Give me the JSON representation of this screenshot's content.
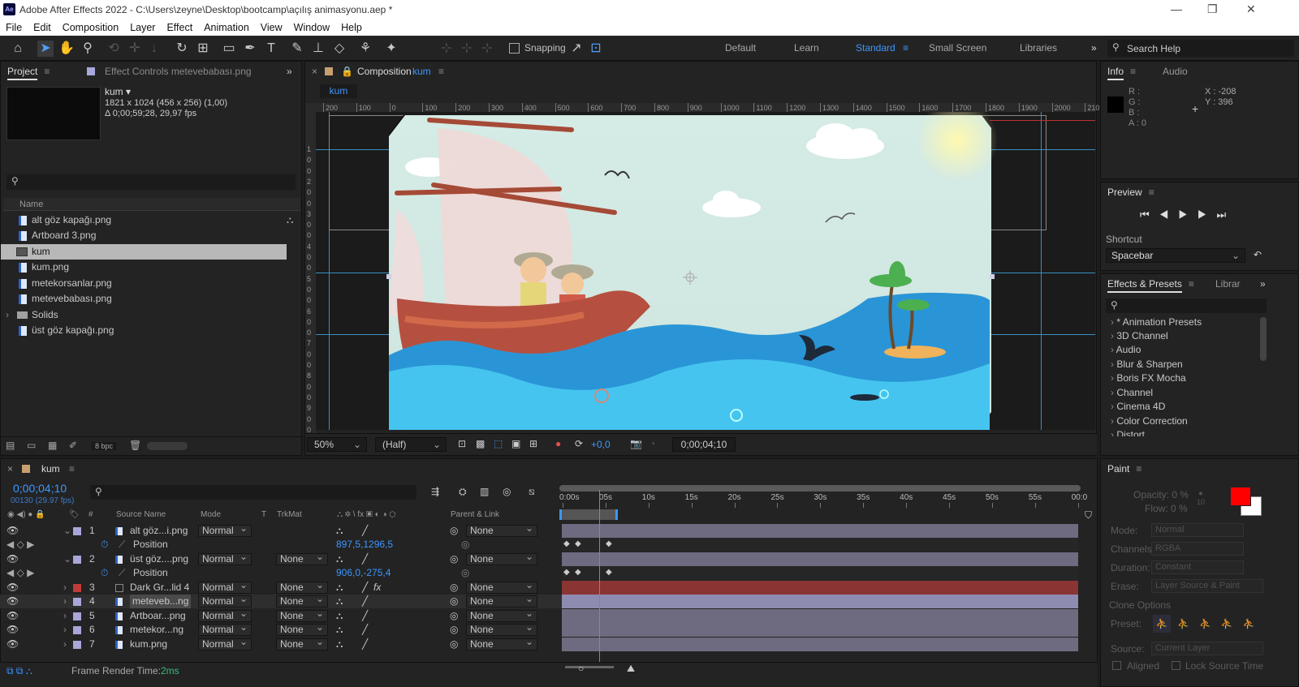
{
  "window": {
    "title": "Adobe After Effects 2022 - C:\\Users\\zeyne\\Desktop\\bootcamp\\açılış animasyonu.aep *",
    "icon": "Ae",
    "min": "—",
    "max": "❐",
    "close": "✕"
  },
  "menu": [
    "File",
    "Edit",
    "Composition",
    "Layer",
    "Effect",
    "Animation",
    "View",
    "Window",
    "Help"
  ],
  "toolbar": {
    "snapping": "Snapping",
    "workspaces": [
      "Default",
      "Learn",
      "Standard",
      "Small Screen",
      "Libraries"
    ],
    "search": "Search Help"
  },
  "project": {
    "tab": "Project",
    "effect_tab": "Effect Controls metevebabası.png",
    "comp_name": "kum ▾",
    "dims": "1821 x 1024  (456 x 256) (1,00)",
    "duration": "Δ 0;00;59;28, 29,97 fps",
    "name_col": "Name",
    "bpc": "8 bpc",
    "items": [
      {
        "name": "alt göz kapağı.png",
        "type": "file"
      },
      {
        "name": "Artboard 3.png",
        "type": "file"
      },
      {
        "name": "kum",
        "type": "comp"
      },
      {
        "name": "kum.png",
        "type": "file"
      },
      {
        "name": "metekorsanlar.png",
        "type": "file"
      },
      {
        "name": "metevebabası.png",
        "type": "file"
      },
      {
        "name": "Solids",
        "type": "folder"
      },
      {
        "name": "üst göz kapağı.png",
        "type": "file"
      }
    ]
  },
  "composition": {
    "tab_prefix": "Composition",
    "tab_name": "kum",
    "sub_tab": "kum",
    "zoom": "50%",
    "resolution": "(Half)",
    "exposure": "+0,0",
    "timecode": "0;00;04;10",
    "ruler": [
      "200",
      "100",
      "0",
      "100",
      "200",
      "300",
      "400",
      "500",
      "600",
      "700",
      "800",
      "900",
      "1000",
      "1100",
      "1200",
      "1300",
      "1400",
      "1500",
      "1600",
      "1700",
      "1800",
      "1900",
      "2000",
      "210"
    ],
    "vruler": [
      "1",
      "0",
      "0",
      "2",
      "0",
      "0",
      "3",
      "0",
      "0",
      "4",
      "0",
      "0",
      "5",
      "0",
      "0",
      "6",
      "0",
      "0",
      "7",
      "0",
      "0",
      "8",
      "0",
      "0",
      "9",
      "0",
      "0"
    ]
  },
  "info": {
    "tab": "Info",
    "audio_tab": "Audio",
    "r": "R :",
    "g": "G :",
    "b": "B :",
    "a": "A :  0",
    "x": "X : -208",
    "y": "Y :  396"
  },
  "preview": {
    "title": "Preview",
    "shortcut_label": "Shortcut",
    "shortcut": "Spacebar"
  },
  "effects": {
    "title": "Effects & Presets",
    "libs": "Librar",
    "items": [
      "* Animation Presets",
      "3D Channel",
      "Audio",
      "Blur & Sharpen",
      "Boris FX Mocha",
      "Channel",
      "Cinema 4D",
      "Color Correction",
      "Distort"
    ]
  },
  "timeline": {
    "tab": "kum",
    "timecode": "0;00;04;10",
    "fps": "00130 (29.97 fps)",
    "headers": {
      "num": "#",
      "source": "Source Name",
      "mode": "Mode",
      "t": "T",
      "trkmat": "TrkMat",
      "parent": "Parent & Link"
    },
    "ticks": [
      "0:00s",
      "05s",
      "10s",
      "15s",
      "20s",
      "25s",
      "30s",
      "35s",
      "40s",
      "45s",
      "50s",
      "55s",
      "00:0"
    ],
    "playhead_seconds": 4.34,
    "duration_seconds": 60,
    "layers": [
      {
        "num": "1",
        "name": "alt göz...i.png",
        "mode": "Normal",
        "trkmat": "",
        "parent": "None",
        "color": "#a9a6d9",
        "expanded": true,
        "prop": "Position",
        "value": "897,5,1296,5"
      },
      {
        "num": "2",
        "name": "üst göz....png",
        "mode": "Normal",
        "trkmat": "None",
        "parent": "None",
        "color": "#a9a6d9",
        "expanded": true,
        "prop": "Position",
        "value": "906,0,-275,4"
      },
      {
        "num": "3",
        "name": "Dark Gr...lid 4",
        "mode": "Normal",
        "trkmat": "None",
        "parent": "None",
        "color": "#c23a3a",
        "bar": "#8a3434",
        "fx": "fx"
      },
      {
        "num": "4",
        "name": "meteveb...ng",
        "mode": "Normal",
        "trkmat": "None",
        "parent": "None",
        "color": "#a9a6d9",
        "bar": "#8e8bb0"
      },
      {
        "num": "5",
        "name": "Artboar...png",
        "mode": "Normal",
        "trkmat": "None",
        "parent": "None",
        "color": "#a9a6d9"
      },
      {
        "num": "6",
        "name": "metekor...ng",
        "mode": "Normal",
        "trkmat": "None",
        "parent": "None",
        "color": "#a9a6d9"
      },
      {
        "num": "7",
        "name": "kum.png",
        "mode": "Normal",
        "trkmat": "None",
        "parent": "None",
        "color": "#a9a6d9"
      }
    ],
    "footer": {
      "label": "Frame Render Time:",
      "value": "2ms"
    }
  },
  "paint": {
    "title": "Paint",
    "opacity": "Opacity: 0 %",
    "flow": "Flow: 0 %",
    "mode_label": "Mode:",
    "mode": "Normal",
    "channels_label": "Channels:",
    "channels": "RGBA",
    "duration_label": "Duration:",
    "duration": "Constant",
    "erase_label": "Erase:",
    "erase": "Layer Source & Paint",
    "clone_options": "Clone Options",
    "preset_label": "Preset:",
    "source_label": "Source:",
    "source": "Current Layer",
    "aligned": "Aligned",
    "lock": "Lock Source Time",
    "brush_size": "10",
    "fg_color": "#ff0000",
    "bg_color": "#ffffff"
  },
  "colors": {
    "accent": "#2d8ceb",
    "canvas_bg": "#cfe6e3",
    "sea": "#3ab0e8",
    "ship": "#b55040"
  }
}
